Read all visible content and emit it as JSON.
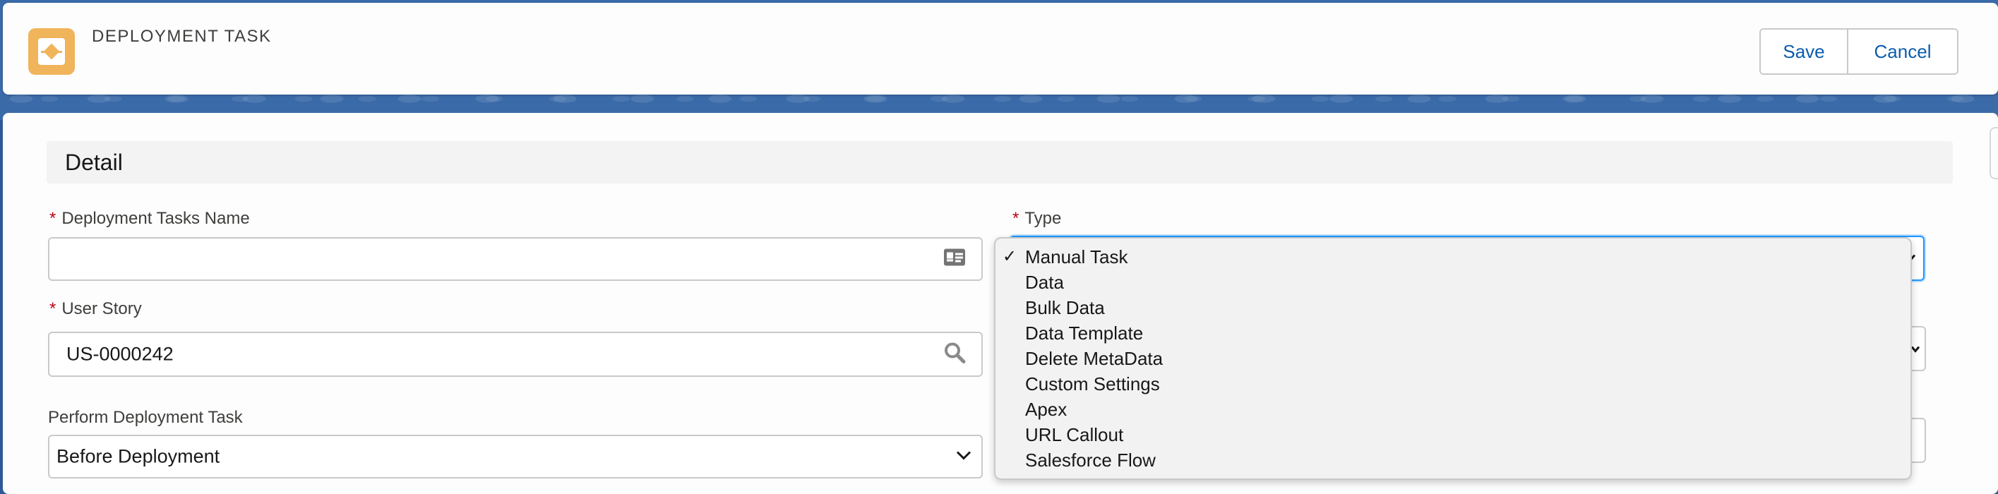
{
  "header": {
    "title": "DEPLOYMENT TASK",
    "save_label": "Save",
    "cancel_label": "Cancel"
  },
  "section": {
    "title": "Detail"
  },
  "form": {
    "name": {
      "label": "Deployment Tasks Name",
      "value": ""
    },
    "type": {
      "label": "Type",
      "selected": "Manual Task"
    },
    "user_story": {
      "label": "User Story",
      "value": "US-0000242"
    },
    "perform": {
      "label": "Perform Deployment Task",
      "value": "Before Deployment"
    },
    "required_marker": "*"
  },
  "type_options": [
    {
      "label": "Manual Task",
      "checked": true
    },
    {
      "label": "Data",
      "checked": false
    },
    {
      "label": "Bulk Data",
      "checked": false
    },
    {
      "label": "Data Template",
      "checked": false
    },
    {
      "label": "Delete MetaData",
      "checked": false
    },
    {
      "label": "Custom Settings",
      "checked": false
    },
    {
      "label": "Apex",
      "checked": false
    },
    {
      "label": "URL Callout",
      "checked": false
    },
    {
      "label": "Salesforce Flow",
      "checked": false
    }
  ],
  "colors": {
    "brand_icon": "#f0b45a",
    "link_blue": "#0b5cab",
    "focus_blue": "#1b96ff",
    "required_red": "#ba0517"
  },
  "icons": {
    "app": "deployment-task-icon",
    "name_field": "contact-card-icon",
    "lookup": "search-icon",
    "select": "chevron-down-icon",
    "check": "checkmark-icon"
  }
}
